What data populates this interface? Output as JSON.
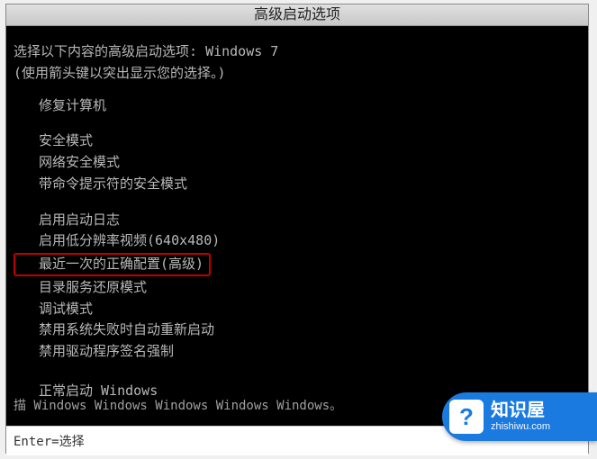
{
  "titlebar": "高级启动选项",
  "instruction": "选择以下内容的高级启动选项: Windows 7",
  "hint": "(使用箭头键以突出显示您的选择。)",
  "options": {
    "repair": "修复计算机",
    "safe": "安全模式",
    "safe_net": "网络安全模式",
    "safe_cmd": "带命令提示符的安全模式",
    "boot_log": "启用启动日志",
    "low_res": "启用低分辨率视频(640x480)",
    "last_known": "最近一次的正确配置(高级)",
    "ds_restore": "目录服务还原模式",
    "debug": "调试模式",
    "no_auto_restart": "禁用系统失败时自动重新启动",
    "no_driver_sig": "禁用驱动程序签名强制",
    "normal": "正常启动 Windows"
  },
  "description": "描 Windows Windows Windows Windows Windows。",
  "bottom": "Enter=选择",
  "watermark": {
    "icon": "?",
    "title": "知识屋",
    "url": "zhishiwu.com"
  }
}
